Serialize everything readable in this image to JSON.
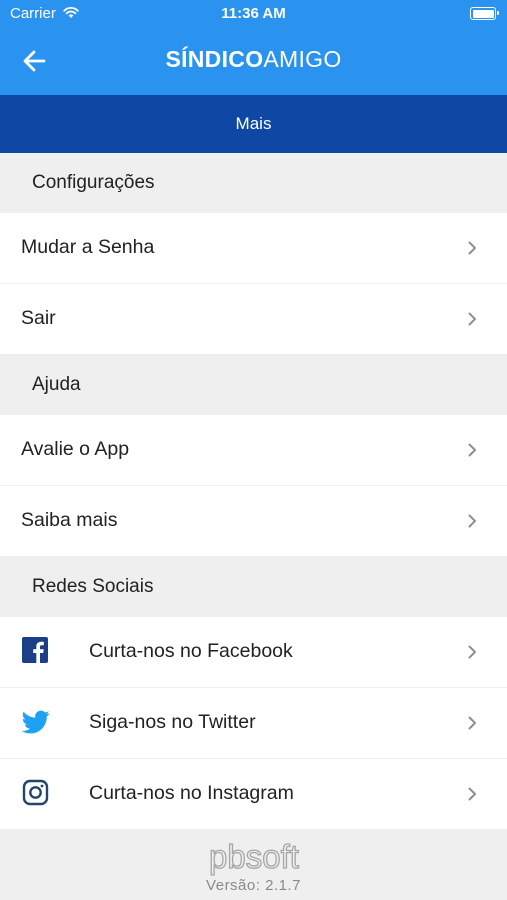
{
  "status": {
    "carrier": "Carrier",
    "time": "11:36 AM"
  },
  "header": {
    "title_bold": "SÍNDICO",
    "title_light": "AMIGO",
    "subtitle": "Mais"
  },
  "sections": [
    {
      "title": "Configurações",
      "items": [
        {
          "label": "Mudar a Senha"
        },
        {
          "label": "Sair"
        }
      ]
    },
    {
      "title": "Ajuda",
      "items": [
        {
          "label": "Avalie o App"
        },
        {
          "label": "Saiba mais"
        }
      ]
    },
    {
      "title": "Redes Sociais",
      "items": [
        {
          "label": "Curta-nos no Facebook",
          "icon": "facebook-icon"
        },
        {
          "label": "Siga-nos no Twitter",
          "icon": "twitter-icon"
        },
        {
          "label": "Curta-nos no Instagram",
          "icon": "instagram-icon"
        }
      ]
    }
  ],
  "footer": {
    "logo_text": "pbsoft",
    "version": "Versão: 2.1.7"
  },
  "colors": {
    "primary": "#2a93f0",
    "dark_primary": "#0f48a4",
    "background": "#efefef",
    "facebook": "#1a3f86",
    "twitter": "#1da1f2",
    "instagram": "#22456d"
  }
}
